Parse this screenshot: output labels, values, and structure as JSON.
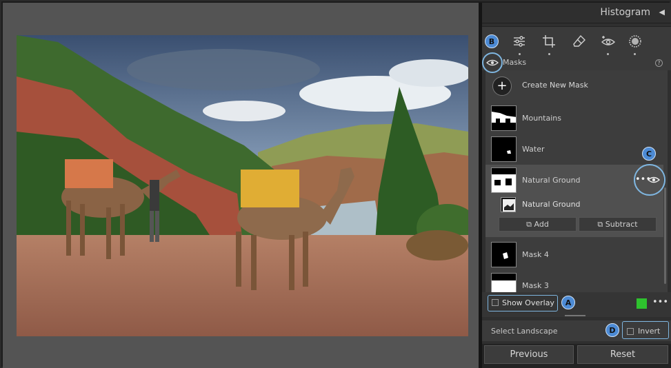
{
  "panel": {
    "header_title": "Histogram",
    "masks_label": "Masks",
    "help_glyph": "?"
  },
  "tools": [
    {
      "name": "edit-sliders-icon"
    },
    {
      "name": "crop-icon"
    },
    {
      "name": "healing-eraser-icon"
    },
    {
      "name": "red-eye-icon"
    },
    {
      "name": "masking-icon"
    }
  ],
  "masks": {
    "create_label": "Create New Mask",
    "items": [
      {
        "label": "Mountains"
      },
      {
        "label": "Water"
      },
      {
        "label": "Natural Ground"
      },
      {
        "label": "Mask 4"
      },
      {
        "label": "Mask 3"
      }
    ],
    "sub_item_label": "Natural Ground",
    "add_label": "Add",
    "subtract_label": "Subtract",
    "row_dots": "•••"
  },
  "overlay": {
    "show_overlay_label": "Show Overlay",
    "swatch_color": "#2ec22e",
    "dots": "•••"
  },
  "selection": {
    "label": "Select Landscape",
    "invert_label": "Invert"
  },
  "bottom": {
    "previous_label": "Previous",
    "reset_label": "Reset"
  },
  "callouts": {
    "a": "A",
    "b": "B",
    "c": "C",
    "d": "D"
  }
}
